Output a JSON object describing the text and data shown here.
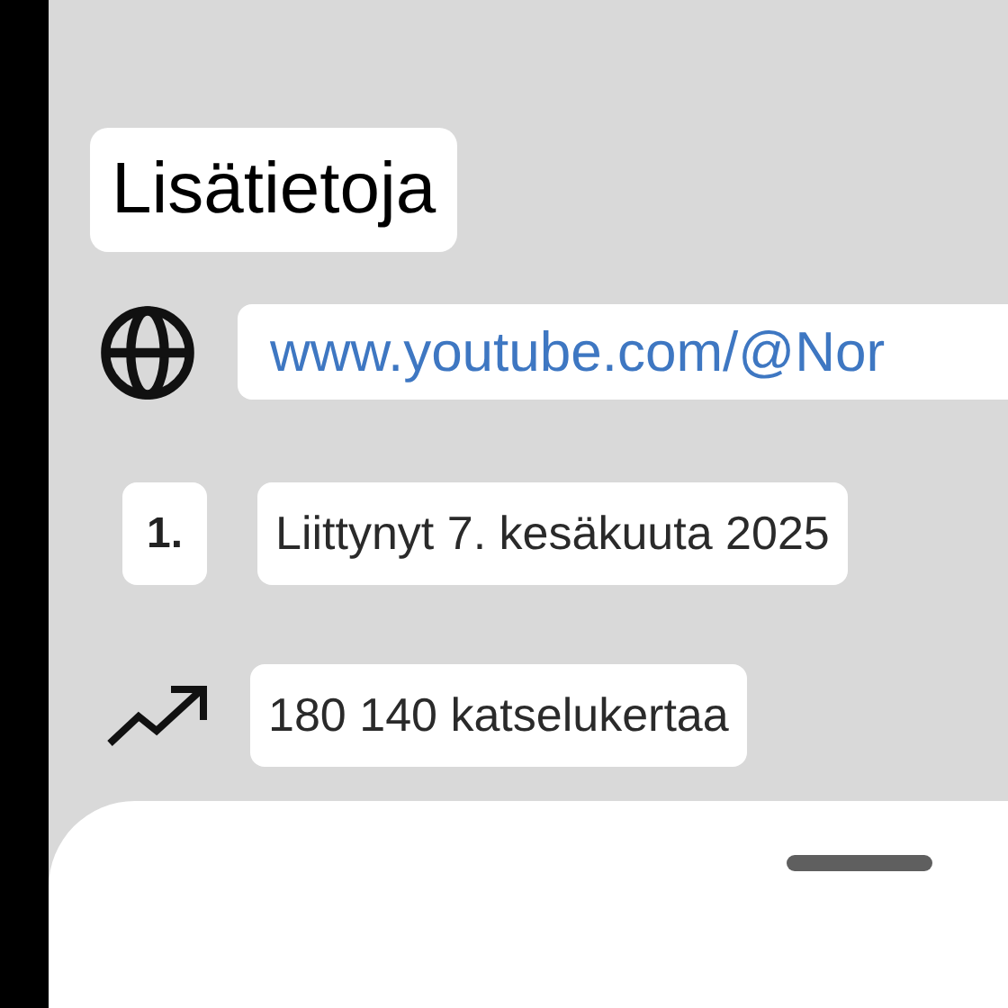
{
  "section": {
    "title": "Lisätietoja"
  },
  "details": [
    {
      "kind": "link",
      "text": "www.youtube.com/@Nor"
    },
    {
      "kind": "joined",
      "badge": "1.",
      "text": "Liittynyt 7. kesäkuuta 2025"
    },
    {
      "kind": "views",
      "text": "180 140 katselukertaa"
    }
  ]
}
